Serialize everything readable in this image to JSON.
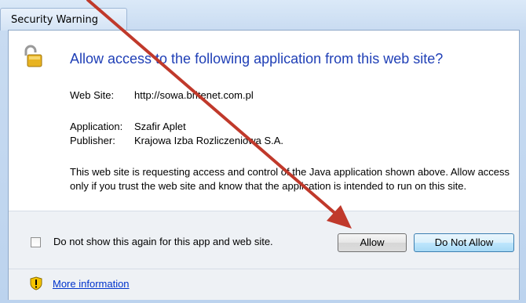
{
  "window": {
    "title": "Security Warning"
  },
  "dialog": {
    "heading": "Allow access to the following application from this web site?",
    "website_label": "Web Site:",
    "website_value": "http://sowa.britenet.com.pl",
    "application_label": "Application:",
    "application_value": "Szafir Aplet",
    "publisher_label": "Publisher:",
    "publisher_value": "Krajowa Izba Rozliczeniowa S.A.",
    "description": "This web site is requesting access and control of the Java application shown above. Allow access only if you trust the web site and know that the application is intended to run on this site."
  },
  "footer": {
    "checkbox_label": "Do not show this again for this app and web site.",
    "checkbox_checked": false,
    "allow_label": "Allow",
    "deny_label": "Do Not Allow",
    "more_info_label": "More information"
  },
  "icons": {
    "lock": "unlocked-padlock-icon",
    "shield": "warning-shield-icon"
  },
  "colors": {
    "heading": "#1f3fb6",
    "link": "#0033cc",
    "annotation_arrow": "#c0392b"
  }
}
